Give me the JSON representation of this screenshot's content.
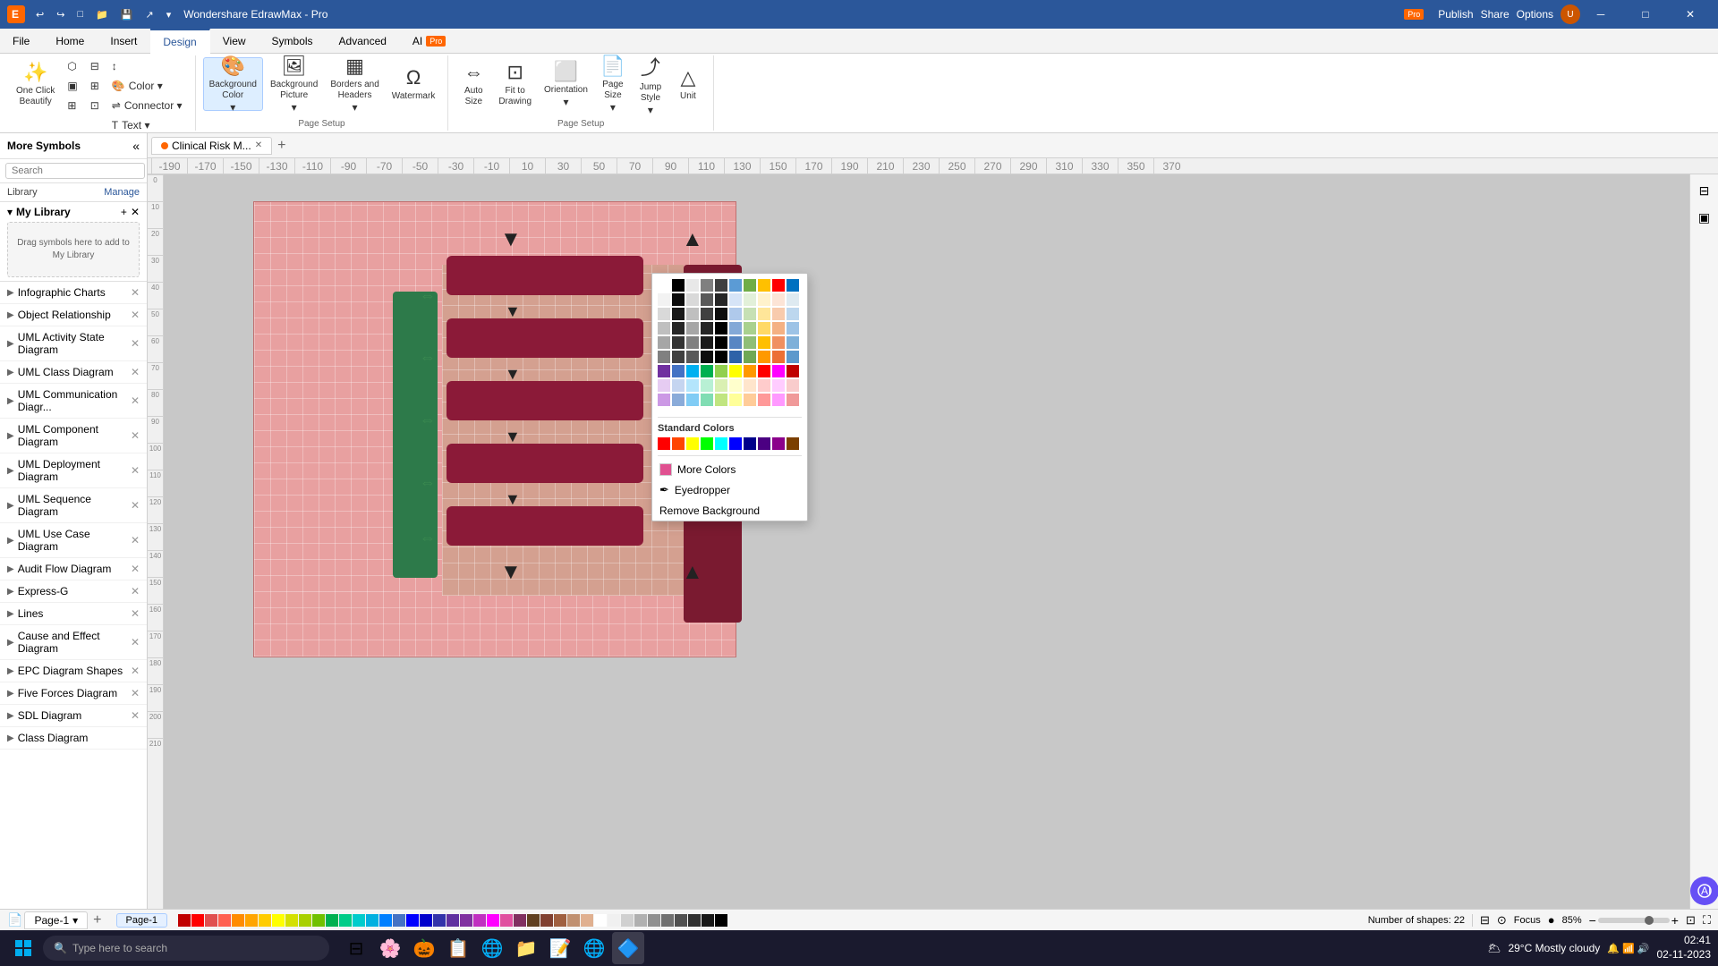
{
  "app": {
    "title": "Wondershare EdrawMax - Pro",
    "logo": "E",
    "pro_badge": "Pro",
    "window_controls": [
      "minimize",
      "maximize",
      "close"
    ]
  },
  "title_bar_menu": [
    "↩",
    "↪",
    "□",
    "📁",
    "💾",
    "↗",
    "▾"
  ],
  "ribbon": {
    "tabs": [
      "File",
      "Home",
      "Insert",
      "Design",
      "View",
      "Symbols",
      "Advanced",
      "AI"
    ],
    "active_tab": "Design",
    "ai_badge": "Pro",
    "groups": {
      "beautify": {
        "label": "Beautify",
        "buttons": [
          "One Click Beautify",
          "select-similar",
          "group",
          "ungroup",
          "align",
          "distribute",
          "arrange"
        ]
      },
      "color_group": {
        "color_label": "Color",
        "connector_label": "Connector",
        "text_label": "Text"
      },
      "background_color": {
        "label": "Background\nColor",
        "icon": "🎨"
      },
      "background_picture": {
        "label": "Background\nPicture",
        "icon": "🖼"
      },
      "borders_headers": {
        "label": "Borders and\nHeaders",
        "icon": "▦"
      },
      "watermark": {
        "label": "Watermark",
        "icon": "Ꞷ"
      },
      "auto_size": {
        "label": "Auto\nSize",
        "icon": "⇔"
      },
      "fit_to_drawing": {
        "label": "Fit to\nDrawing",
        "icon": "⊡"
      },
      "orientation": {
        "label": "Orientation",
        "icon": "⬜"
      },
      "page_size": {
        "label": "Page\nSize",
        "icon": "📄"
      },
      "jump_style": {
        "label": "Jump\nStyle",
        "icon": "⤴"
      },
      "unit": {
        "label": "Unit",
        "icon": "△"
      },
      "page_setup_label": "Page Setup"
    }
  },
  "sidebar": {
    "title": "More Symbols",
    "search_placeholder": "Search",
    "search_btn": "Search",
    "library_label": "Library",
    "manage_label": "Manage",
    "my_library": {
      "title": "My Library",
      "drag_hint": "Drag symbols here to add to My Library"
    },
    "items": [
      {
        "label": "Infographic Charts",
        "has_close": true
      },
      {
        "label": "Object Relationship",
        "has_close": true
      },
      {
        "label": "UML Activity State Diagram",
        "has_close": true
      },
      {
        "label": "UML Class Diagram",
        "has_close": true
      },
      {
        "label": "UML Communication Diagr...",
        "has_close": true
      },
      {
        "label": "UML Component Diagram",
        "has_close": true
      },
      {
        "label": "UML Deployment Diagram",
        "has_close": true
      },
      {
        "label": "UML Sequence Diagram",
        "has_close": true
      },
      {
        "label": "UML Use Case Diagram",
        "has_close": true
      },
      {
        "label": "Audit Flow Diagram",
        "has_close": true
      },
      {
        "label": "Express-G",
        "has_close": true
      },
      {
        "label": "Lines",
        "has_close": true
      },
      {
        "label": "Cause and Effect Diagram",
        "has_close": true
      },
      {
        "label": "EPC Diagram Shapes",
        "has_close": true
      },
      {
        "label": "Five Forces Diagram",
        "has_close": true
      },
      {
        "label": "SDL Diagram",
        "has_close": true
      },
      {
        "label": "Class Diagram",
        "has_close": false
      }
    ]
  },
  "canvas": {
    "tab": "Clinical Risk M...",
    "tab_add": "+",
    "ruler_labels": [
      "-190",
      "-170",
      "-150",
      "-130",
      "-110",
      "-90",
      "-70",
      "-50",
      "-30",
      "-10",
      "10",
      "30",
      "50",
      "70",
      "90",
      "110",
      "130",
      "150",
      "170",
      "190",
      "210",
      "230",
      "250",
      "270",
      "290",
      "310",
      "330",
      "350",
      "370"
    ]
  },
  "color_picker": {
    "standard_colors_label": "Standard Colors",
    "more_colors_label": "More Colors",
    "eyedropper_label": "Eyedropper",
    "remove_background_label": "Remove Background",
    "theme_colors": [
      [
        "#ffffff",
        "#000000",
        "#e0e0e0",
        "#808080",
        "#404040",
        "#4472c4",
        "#70ad47",
        "#ffc000",
        "#ff0000",
        "#0070c0"
      ],
      [
        "#f2f2f2",
        "#0d0d0d",
        "#d9d9d9",
        "#595959",
        "#262626",
        "#d6e4f7",
        "#e2f0d9",
        "#fff2cc",
        "#fce4d6",
        "#deeaf1"
      ],
      [
        "#d9d9d9",
        "#1a1a1a",
        "#bfbfbf",
        "#404040",
        "#0d0d0d",
        "#afc9eb",
        "#c6e0b4",
        "#ffe699",
        "#f8cbad",
        "#bdd7ee"
      ],
      [
        "#bfbfbf",
        "#262626",
        "#a6a6a6",
        "#262626",
        "#000000",
        "#84a9d7",
        "#a9d18e",
        "#ffd966",
        "#f4b183",
        "#9dc3e6"
      ],
      [
        "#a6a6a6",
        "#333333",
        "#808080",
        "#1a1a1a",
        "#000000",
        "#5886c3",
        "#8fbe76",
        "#ffbf00",
        "#f09060",
        "#7eb0d9"
      ],
      [
        "#808080",
        "#404040",
        "#595959",
        "#0d0d0d",
        "#000000",
        "#2e62a8",
        "#6fa854",
        "#ff9900",
        "#ec7035",
        "#5d99cc"
      ]
    ],
    "standard_row": [
      "#ff0000",
      "#ff6600",
      "#ffff00",
      "#00ff00",
      "#00ffff",
      "#0000ff",
      "#7030a0",
      "#ff00ff",
      "#804040",
      "#004080"
    ]
  },
  "status_bar": {
    "page_icon": "📄",
    "page_label": "Page-1",
    "page_dropdown": "▾",
    "add_page": "+",
    "page_tab_1": "Page-1",
    "shapes_count": "Number of shapes: 22",
    "focus_label": "Focus",
    "zoom_level": "85%",
    "zoom_out": "-",
    "zoom_in": "+"
  },
  "taskbar": {
    "search_placeholder": "Type here to search",
    "clock_time": "02:41",
    "clock_date": "02-11-2023",
    "weather": "29°C  Mostly cloudy",
    "apps": [
      "🪟",
      "🔍",
      "🌸",
      "🎃",
      "📋",
      "🌐",
      "📁",
      "📝",
      "🌐",
      "🔷"
    ]
  },
  "publish_btn": "Publish",
  "share_btn": "Share",
  "options_btn": "Options"
}
